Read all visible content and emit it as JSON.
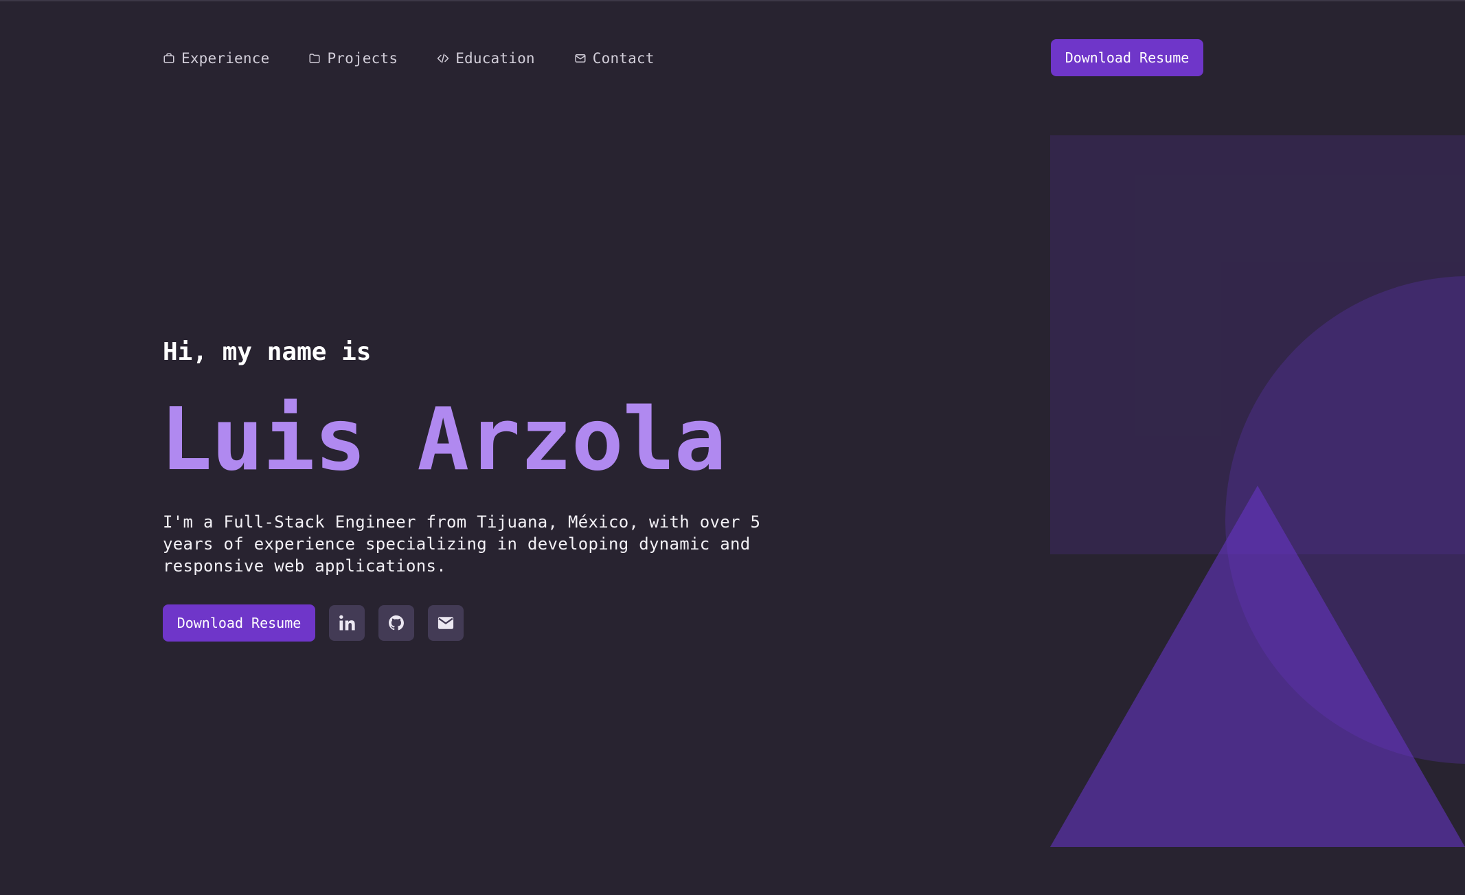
{
  "nav": {
    "items": [
      {
        "label": "Experience",
        "icon": "briefcase-icon"
      },
      {
        "label": "Projects",
        "icon": "folder-icon"
      },
      {
        "label": "Education",
        "icon": "code-icon"
      },
      {
        "label": "Contact",
        "icon": "mail-icon"
      }
    ],
    "resume_button": "Download Resume"
  },
  "hero": {
    "greeting": "Hi, my name is",
    "name": "Luis Arzola",
    "bio": "I'm a Full-Stack Engineer from Tijuana, México, with over 5 years of experience specializing in developing dynamic and responsive web applications.",
    "resume_button": "Download Resume",
    "socials": [
      {
        "icon": "linkedin-icon"
      },
      {
        "icon": "github-icon"
      },
      {
        "icon": "email-icon"
      }
    ]
  },
  "colors": {
    "background": "#282330",
    "accent": "#6f36c9",
    "name": "#b089f0",
    "social_bg": "#433b55"
  }
}
